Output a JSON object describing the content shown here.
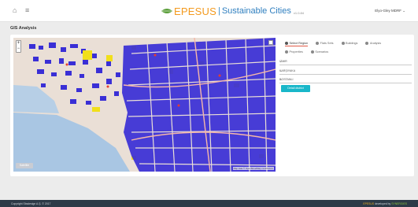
{
  "header": {
    "brand_name": "EPESUS",
    "brand_separator": "|",
    "brand_tagline": "Sustainable Cities",
    "brand_version": "v1.0.84",
    "user_menu": "Elyo-Gley MDRF"
  },
  "page": {
    "title": "GIS Analysis"
  },
  "panel": {
    "tabs": [
      {
        "label": "Select Region",
        "active": true
      },
      {
        "label": "Flats Sets",
        "active": false
      },
      {
        "label": "Buildings",
        "active": false
      },
      {
        "label": "Analysis",
        "active": false
      },
      {
        "label": "Properties",
        "active": false
      },
      {
        "label": "Scenarios",
        "active": false
      }
    ],
    "selects": [
      {
        "value": "IZMIR"
      },
      {
        "value": "KARŞIYAKA"
      },
      {
        "value": "BOSTANLI"
      }
    ],
    "action_button": "Detail district"
  },
  "map": {
    "zoom_in": "+",
    "zoom_out": "−",
    "basemap_button": "Satellite",
    "attribution": "Map data © OpenStreetMap contributors"
  },
  "footer": {
    "copyright": "Copyright Sbsdesign A.Ş. © 2017",
    "developed_brand": "EPESUS",
    "developed_text": "developed by",
    "developer": "SYNERGIES"
  },
  "colors": {
    "accent": "#19b7c9",
    "brand_orange": "#f39a1e",
    "brand_blue": "#2f7fbf",
    "footer_bg": "#2d3a47",
    "building_fill": "#3a2fd6",
    "water": "#a9c6e3"
  }
}
